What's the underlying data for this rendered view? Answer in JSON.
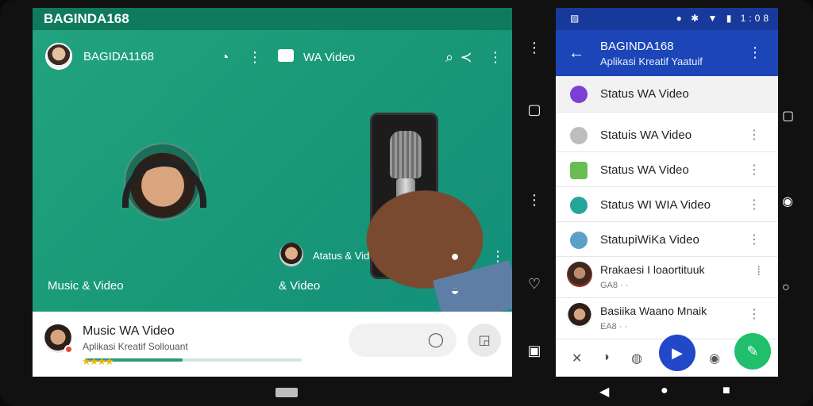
{
  "left_panel": {
    "app_title": "BAGINDA168",
    "chat_name": "BAGIDA1168",
    "video_title": "WA Video",
    "mini_label": "Atatus & Vid",
    "music_label": "Music & Video",
    "video_label": "& Video",
    "player": {
      "title": "Music WA Video",
      "subtitle": "Aplikasi Kreatif Sollouant",
      "stars": "★★★★",
      "progress": 0.45
    }
  },
  "right_panel": {
    "status": {
      "time": "1:08"
    },
    "header": {
      "title": "BAGINDA168",
      "subtitle": "Aplikasi Kreatif Yaatuif"
    },
    "list": [
      {
        "label": "Status WA Video"
      },
      {
        "label": "Statuis WA Video"
      },
      {
        "label": "Status WA Video"
      },
      {
        "label": "Status WI WIA Video"
      },
      {
        "label": "StatupiWiKa Video"
      },
      {
        "label": "Rrakaesi I loaortituuk",
        "sub": "GA8 · ·"
      },
      {
        "label": "Basiika Waano Mnaik",
        "sub": "EA8 · ·"
      }
    ]
  }
}
